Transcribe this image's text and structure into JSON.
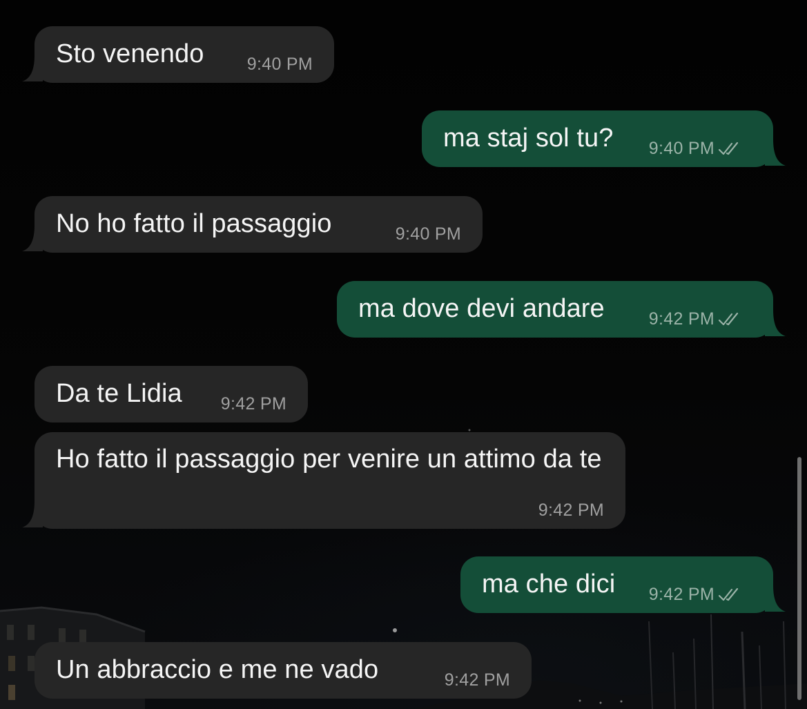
{
  "chat": {
    "messages": [
      {
        "direction": "incoming",
        "text": "Sto venendo",
        "time": "9:40 PM"
      },
      {
        "direction": "outgoing",
        "text": "ma staj sol tu?",
        "time": "9:40 PM",
        "status_icon": "double-check-icon"
      },
      {
        "direction": "incoming",
        "text": "No ho fatto il passaggio",
        "time": "9:40 PM"
      },
      {
        "direction": "outgoing",
        "text": "ma dove devi andare",
        "time": "9:42 PM",
        "status_icon": "double-check-icon"
      },
      {
        "direction": "incoming",
        "text": "Da te Lidia",
        "time": "9:42 PM"
      },
      {
        "direction": "incoming",
        "text": "Ho fatto il passaggio per venire un attimo da te",
        "time": "9:42 PM"
      },
      {
        "direction": "outgoing",
        "text": "ma che dici",
        "time": "9:42 PM",
        "status_icon": "double-check-icon"
      },
      {
        "direction": "incoming",
        "text": "Un abbraccio e me ne vado",
        "time": "9:42 PM"
      }
    ]
  },
  "colors": {
    "background": "#030303",
    "incoming_bubble": "#262626",
    "outgoing_bubble": "#144e38",
    "message_text": "#f5f5f5",
    "timestamp": "#a0a0a0",
    "scrollbar": "#6f6f6f"
  }
}
